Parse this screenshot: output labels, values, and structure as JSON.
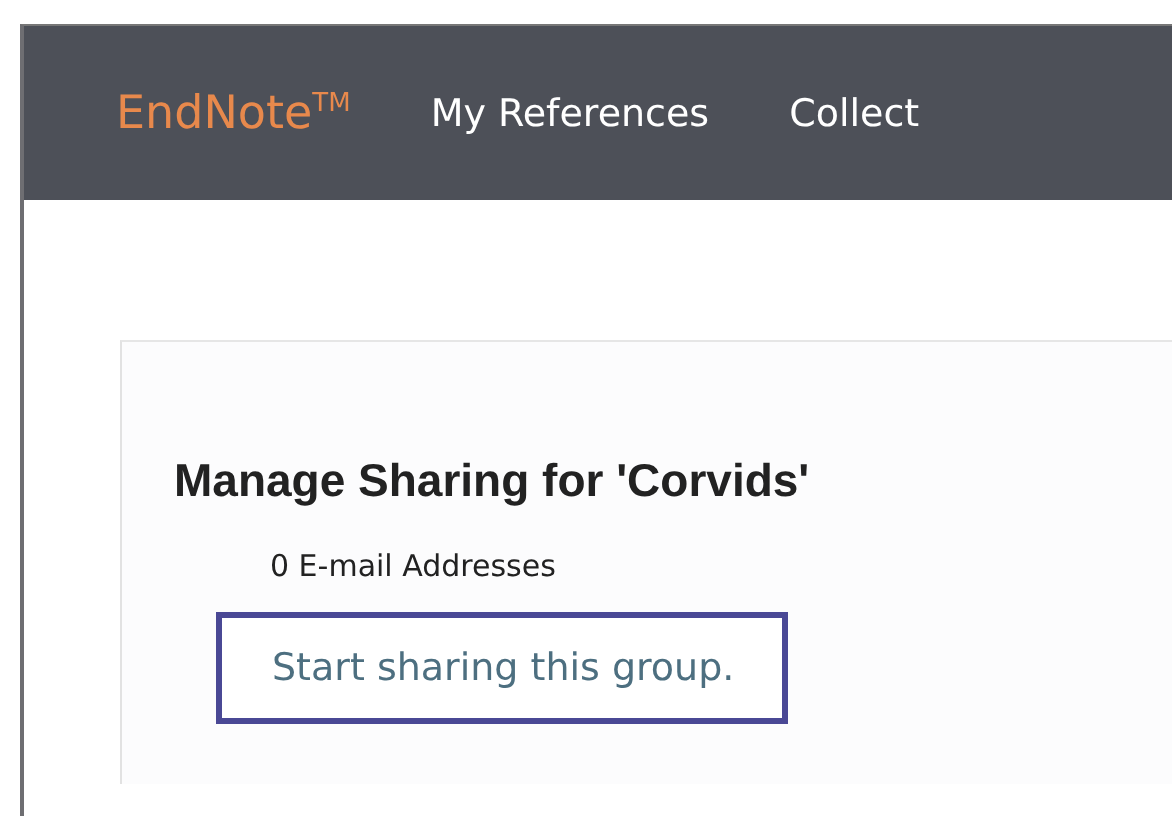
{
  "header": {
    "logo": "EndNote$^{TM}$",
    "nav": [
      {
        "label": "My References"
      },
      {
        "label": "Collect"
      }
    ]
  },
  "panel": {
    "title": "Manage Sharing for 'Corvids'",
    "email_count": "0 E-mail Addresses",
    "button": "Start sharing this group."
  }
}
